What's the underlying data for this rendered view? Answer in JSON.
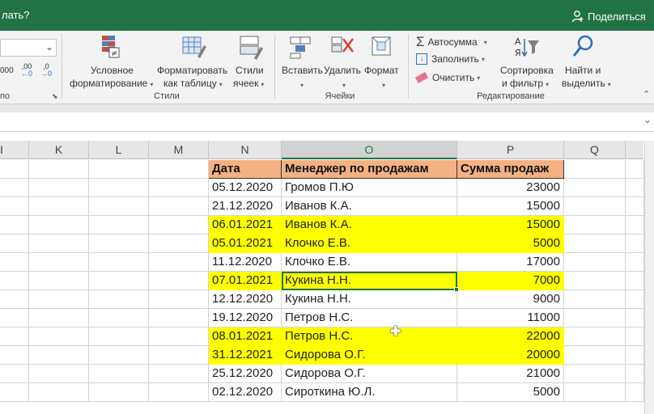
{
  "titlebar": {
    "question_text": "лать?",
    "share_label": "Поделиться"
  },
  "ribbon": {
    "left_partial_label": "по",
    "numfmt": {
      "a": "000",
      "b": ",00",
      "c": ",0"
    },
    "styles_group": {
      "label": "Стили",
      "buttons": [
        {
          "line1": "Условное",
          "line2": "форматирование"
        },
        {
          "line1": "Форматировать",
          "line2": "как таблицу"
        },
        {
          "line1": "Стили",
          "line2": "ячеек"
        }
      ]
    },
    "cells_group": {
      "label": "Ячейки",
      "buttons": [
        {
          "label": "Вставить"
        },
        {
          "label": "Удалить"
        },
        {
          "label": "Формат"
        }
      ]
    },
    "editing_group": {
      "label": "Редактирование",
      "autosum": "Автосумма",
      "fill": "Заполнить",
      "clear": "Очистить",
      "sort": {
        "line1": "Сортировка",
        "line2": "и фильтр"
      },
      "find": {
        "line1": "Найти и",
        "line2": "выделить"
      }
    }
  },
  "grid": {
    "columns": [
      "I",
      "K",
      "L",
      "M",
      "N",
      "O",
      "P",
      "Q"
    ],
    "header_row": {
      "date": "Дата",
      "manager": "Менеджер по продажам",
      "sum": "Сумма продаж"
    },
    "rows": [
      {
        "date": "05.12.2020",
        "manager": "Громов П.Ю",
        "sum": "23000",
        "highlight": false
      },
      {
        "date": "21.12.2020",
        "manager": "Иванов К.А.",
        "sum": "15000",
        "highlight": false
      },
      {
        "date": "06.01.2021",
        "manager": "Иванов К.А.",
        "sum": "15000",
        "highlight": true
      },
      {
        "date": "05.01.2021",
        "manager": "Клочко Е.В.",
        "sum": "5000",
        "highlight": true
      },
      {
        "date": "11.12.2020",
        "manager": "Клочко Е.В.",
        "sum": "17000",
        "highlight": false
      },
      {
        "date": "07.01.2021",
        "manager": "Кукина Н.Н.",
        "sum": "7000",
        "highlight": true
      },
      {
        "date": "12.12.2020",
        "manager": "Кукина Н.Н.",
        "sum": "9000",
        "highlight": false
      },
      {
        "date": "19.12.2020",
        "manager": "Петров Н.С.",
        "sum": "11000",
        "highlight": false
      },
      {
        "date": "08.01.2021",
        "manager": "Петров Н.С.",
        "sum": "22000",
        "highlight": true
      },
      {
        "date": "31.12.2021",
        "manager": "Сидорова  О.Г.",
        "sum": "20000",
        "highlight": true
      },
      {
        "date": "25.12.2020",
        "manager": "Сидорова  О.Г.",
        "sum": "21000",
        "highlight": false
      },
      {
        "date": "02.12.2020",
        "manager": "Сироткина Ю.Л.",
        "sum": "5000",
        "highlight": false
      }
    ],
    "highlight_color": "#ffff00",
    "header_color": "#f4b183",
    "accent_color": "#217346"
  }
}
